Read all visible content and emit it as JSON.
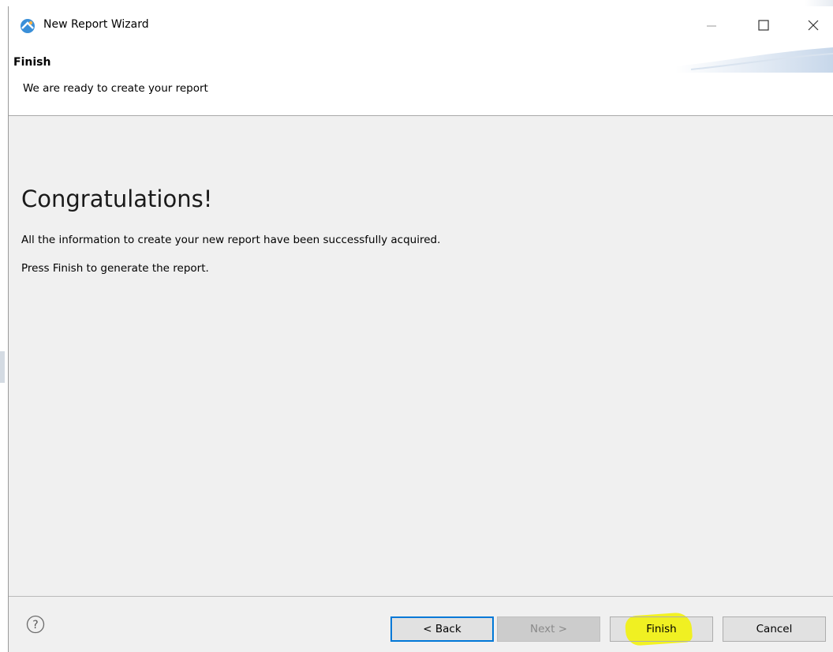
{
  "window": {
    "title": "New Report Wizard",
    "app_icon": "eclipse-birt-icon",
    "controls": {
      "minimize_icon": "minimize-icon",
      "maximize_icon": "maximize-icon",
      "close_icon": "close-icon"
    }
  },
  "header": {
    "title": "Finish",
    "description": "We are ready to create your report"
  },
  "content": {
    "heading": "Congratulations!",
    "paragraph1": "All the information to create your new report have been successfully acquired.",
    "paragraph2": "Press Finish to generate the report."
  },
  "footer": {
    "help_icon": "help-icon",
    "back_label": "< Back",
    "next_label": "Next >",
    "finish_label": "Finish",
    "cancel_label": "Cancel",
    "next_enabled": false,
    "highlight_color": "#f2f200"
  },
  "colors": {
    "accent": "#0078d7",
    "panel": "#f0f0f0",
    "header_bg": "#ffffff"
  }
}
